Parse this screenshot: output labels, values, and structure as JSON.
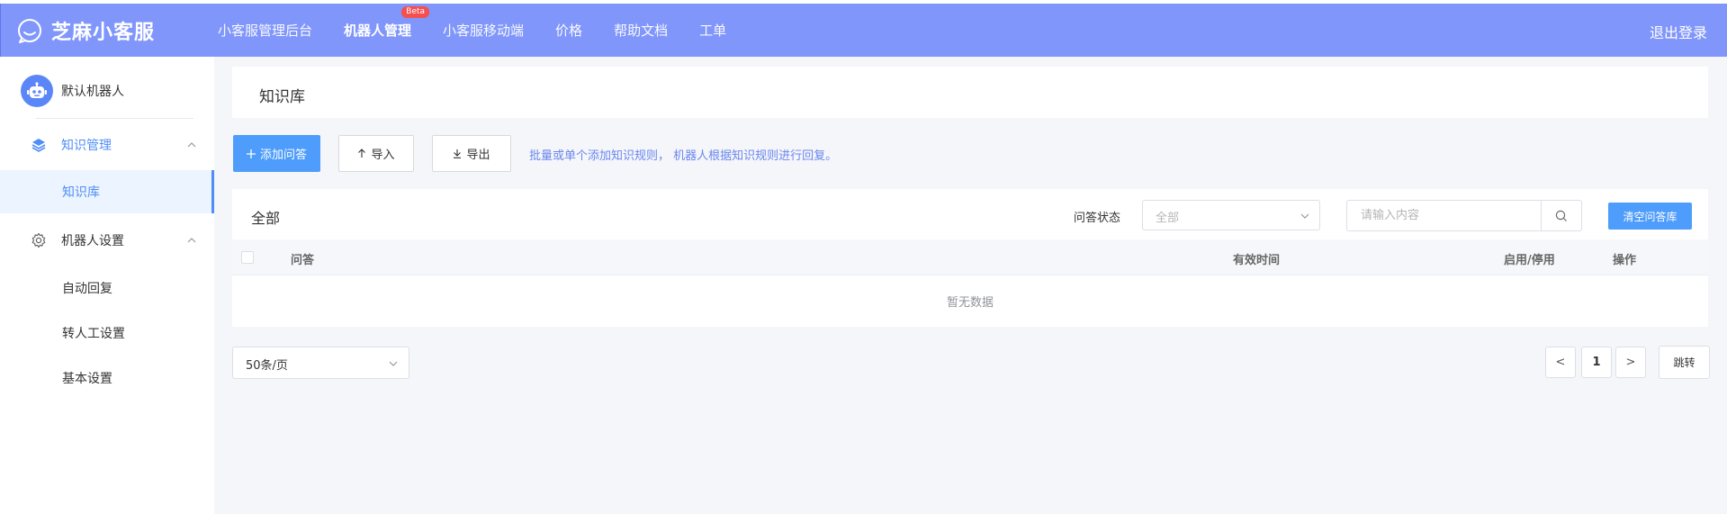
{
  "header": {
    "brand": "芝麻小客服",
    "nav": [
      {
        "label": "小客服管理后台"
      },
      {
        "label": "机器人管理",
        "badge": "Beta"
      },
      {
        "label": "小客服移动端"
      },
      {
        "label": "价格"
      },
      {
        "label": "帮助文档"
      },
      {
        "label": "工单"
      }
    ],
    "logout": "退出登录"
  },
  "sidebar": {
    "robot_name": "默认机器人",
    "groups": [
      {
        "label": "知识管理",
        "items": [
          {
            "label": "知识库"
          }
        ]
      },
      {
        "label": "机器人设置",
        "items": [
          {
            "label": "自动回复"
          },
          {
            "label": "转人工设置"
          },
          {
            "label": "基本设置"
          }
        ]
      }
    ]
  },
  "main": {
    "page_title": "知识库",
    "toolbar": {
      "add_label": "添加问答",
      "import_label": "导入",
      "export_label": "导出",
      "hint": "批量或单个添加知识规则， 机器人根据知识规则进行回复。"
    },
    "table": {
      "title": "全部",
      "filter_label": "问答状态",
      "filter_value": "全部",
      "search_placeholder": "请输入内容",
      "clear_label": "清空问答库",
      "columns": [
        "问答",
        "有效时间",
        "启用/停用",
        "操作"
      ],
      "empty_text": "暂无数据"
    },
    "pagination": {
      "page_size": "50条/页",
      "prev": "<",
      "current": "1",
      "next": ">",
      "jump": "跳转"
    }
  },
  "colors": {
    "header_bg": "#8096fb",
    "accent": "#4e9cfb",
    "sidebar_active": "#4f8ef7",
    "hint": "#6b86f0"
  }
}
